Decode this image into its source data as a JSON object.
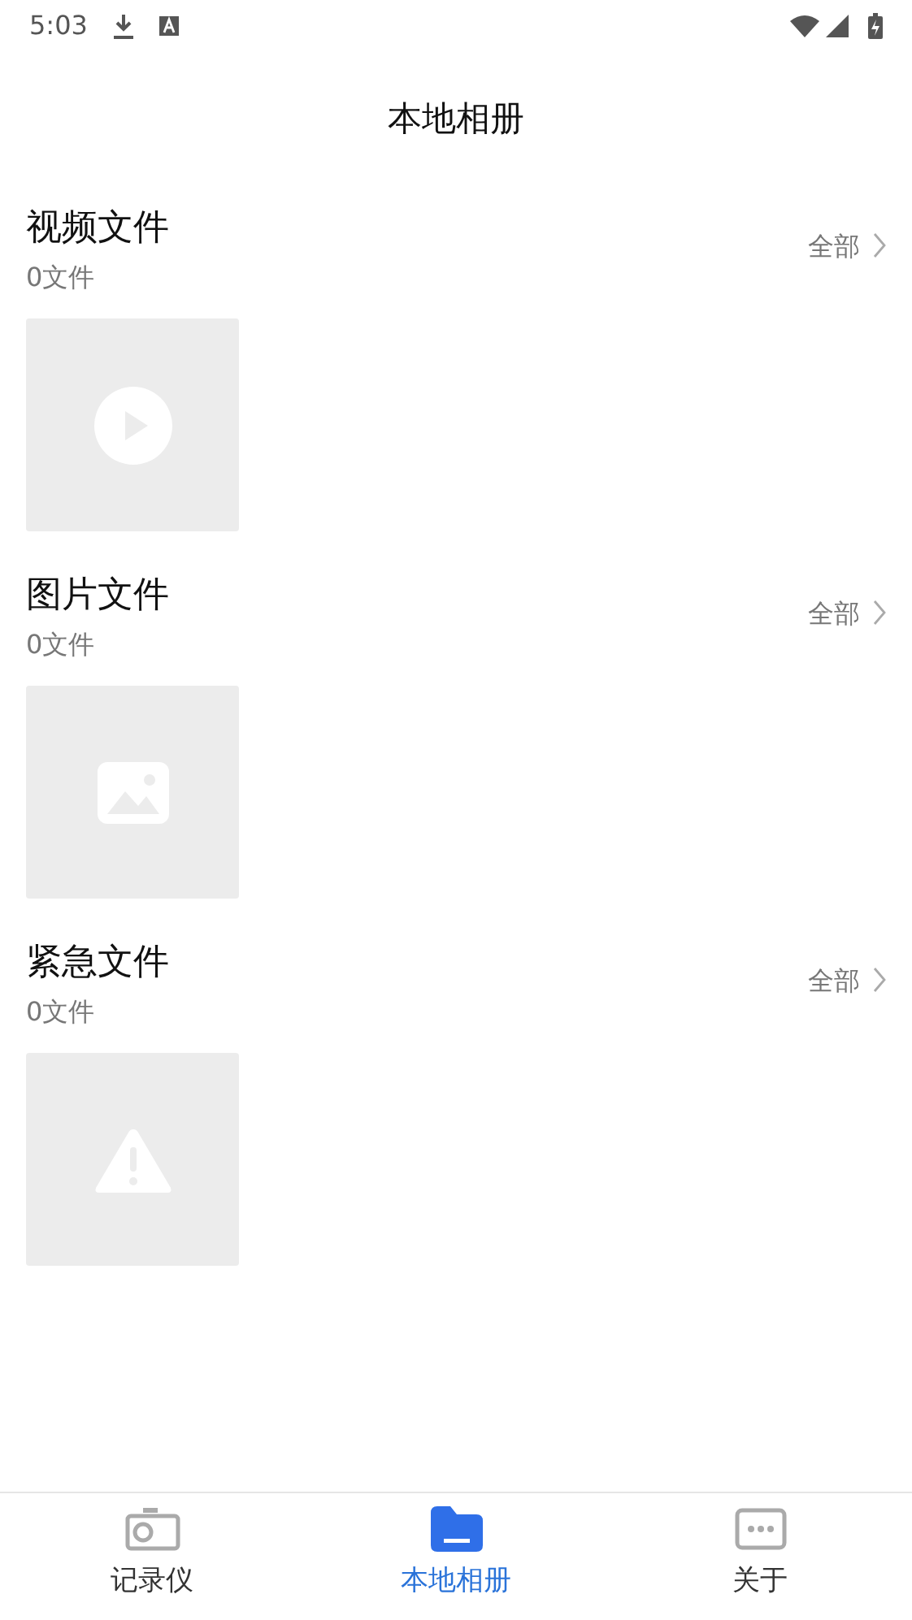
{
  "status_bar": {
    "time": "5:03"
  },
  "title": "本地相册",
  "sections": [
    {
      "title": "视频文件",
      "count": "0文件",
      "more": "全部",
      "kind": "video"
    },
    {
      "title": "图片文件",
      "count": "0文件",
      "more": "全部",
      "kind": "image"
    },
    {
      "title": "紧急文件",
      "count": "0文件",
      "more": "全部",
      "kind": "warning"
    }
  ],
  "tabs": [
    {
      "label": "记录仪",
      "kind": "camera",
      "selected": false
    },
    {
      "label": "本地相册",
      "kind": "folder",
      "selected": true
    },
    {
      "label": "关于",
      "kind": "more",
      "selected": false
    }
  ]
}
